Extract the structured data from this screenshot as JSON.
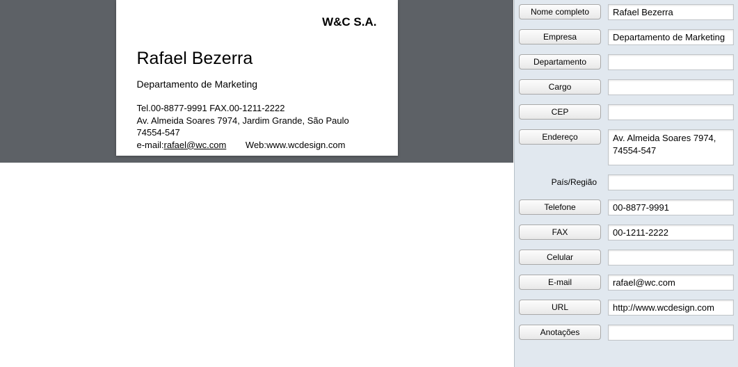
{
  "card": {
    "company": "W&C S.A.",
    "name": "Rafael Bezerra",
    "department": "Departamento de Marketing",
    "telfax": "Tel.00-8877-9991   FAX.00-1211-2222",
    "address": "Av. Almeida Soares 7974, Jardim Grande, São Paulo 74554-547",
    "email_label": "e-mail: ",
    "email": "rafael@wc.com",
    "web_label": "Web: ",
    "web": "www.wcdesign.com"
  },
  "form": {
    "nome_label": "Nome completo",
    "nome_value": "Rafael Bezerra",
    "empresa_label": "Empresa",
    "empresa_value": "Departamento de Marketing",
    "departamento_label": "Departamento",
    "departamento_value": "",
    "cargo_label": "Cargo",
    "cargo_value": "",
    "cep_label": "CEP",
    "cep_value": "",
    "endereco_label": "Endereço",
    "endereco_value": "Av. Almeida Soares 7974, 74554-547",
    "pais_label": "País/Região",
    "pais_value": "",
    "telefone_label": "Telefone",
    "telefone_value": "00-8877-9991",
    "fax_label": "FAX",
    "fax_value": "00-1211-2222",
    "celular_label": "Celular",
    "celular_value": "",
    "email_label": "E-mail",
    "email_value": "rafael@wc.com",
    "url_label": "URL",
    "url_value": "http://www.wcdesign.com",
    "anotacoes_label": "Anotações",
    "anotacoes_value": ""
  }
}
